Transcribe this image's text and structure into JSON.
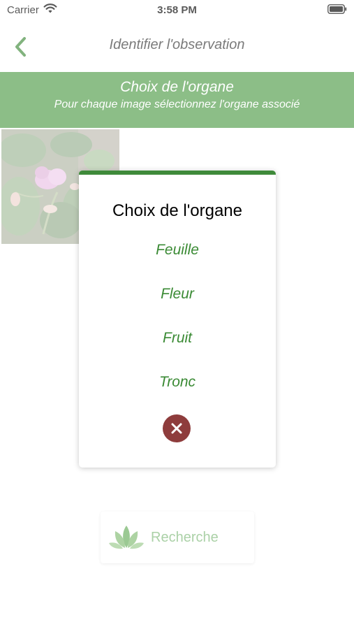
{
  "status_bar": {
    "carrier": "Carrier",
    "time": "3:58 PM"
  },
  "nav": {
    "title": "Identifier l'observation"
  },
  "banner": {
    "title": "Choix de l'organe",
    "subtitle": "Pour chaque image sélectionnez l'organe associé"
  },
  "modal": {
    "title": "Choix de l'organe",
    "options": [
      {
        "label": "Feuille"
      },
      {
        "label": "Fleur"
      },
      {
        "label": "Fruit"
      },
      {
        "label": "Tronc"
      }
    ]
  },
  "search_button": {
    "label": "Recherche"
  },
  "colors": {
    "brand_green": "#4f9b48",
    "option_green": "#3a8a34",
    "close_red": "#8e3c3c"
  },
  "icons": [
    "wifi-icon",
    "battery-icon",
    "back-chevron-icon",
    "close-icon",
    "leaves-icon"
  ]
}
